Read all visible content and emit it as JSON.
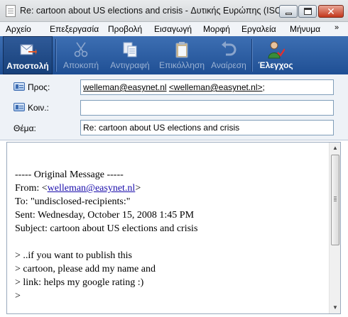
{
  "window": {
    "title": "Re: cartoon about US elections and crisis - Δυτικής Ευρώπης (ISO)",
    "close_glyph": "✕"
  },
  "menu": [
    "Αρχείο",
    "Επεξεργασία",
    "Προβολή",
    "Εισαγωγή",
    "Μορφή",
    "Εργαλεία",
    "Μήνυμα"
  ],
  "menu_more": "»",
  "toolbar": {
    "send": "Αποστολή",
    "cut": "Αποκοπή",
    "copy": "Αντιγραφή",
    "paste": "Επικόλληση",
    "undo": "Αναίρεση",
    "check": "Έλεγχος"
  },
  "header": {
    "to_label": "Προς:",
    "to_link": "welleman@easynet.nl",
    "to_rest_link": "<welleman@easynet.nl>",
    "to_suffix": ";",
    "cc_label": "Κοιν.:",
    "cc_value": "",
    "subject_label": "Θέμα:",
    "subject_value": "Re: cartoon about US elections and crisis"
  },
  "message": {
    "separator": "----- Original Message -----",
    "from_prefix": "From: <",
    "from_link": "welleman@easynet.nl",
    "from_suffix": ">",
    "to_line": "To: \"undisclosed-recipients:\"",
    "sent_line": "Sent: Wednesday, October 15, 2008 1:45 PM",
    "subject_line": "Subject: cartoon about US elections and crisis",
    "quote1": "> ..if you want to publish this",
    "quote2": "> cartoon, please add my name and",
    "quote3": "> link: helps my google rating :)",
    "quote4": ">"
  },
  "scroll": {
    "up": "▲",
    "down": "▼"
  }
}
